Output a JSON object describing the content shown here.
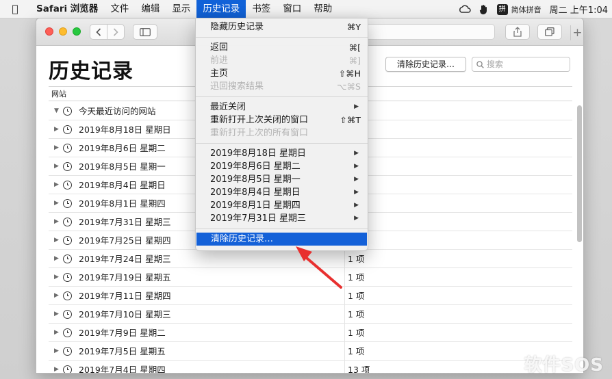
{
  "menubar": {
    "app_name": "Safari 浏览器",
    "menus": [
      "文件",
      "编辑",
      "显示",
      "历史记录",
      "书签",
      "窗口",
      "帮助"
    ],
    "active_menu": "历史记录",
    "input_method": {
      "badge": "拼",
      "label": "简体拼音"
    },
    "clock": "周二 上午1:04"
  },
  "history_menu": {
    "items": [
      {
        "label": "隐藏历史记录",
        "shortcut": "⌘Y",
        "disabled": false
      },
      {
        "sep": true
      },
      {
        "label": "返回",
        "shortcut": "⌘[",
        "disabled": false
      },
      {
        "label": "前进",
        "shortcut": "⌘]",
        "disabled": true
      },
      {
        "label": "主页",
        "shortcut": "⇧⌘H",
        "disabled": false
      },
      {
        "label": "迅回搜索结果",
        "shortcut": "⌥⌘S",
        "disabled": true
      },
      {
        "sep": true
      },
      {
        "label": "最近关闭",
        "submenu": true,
        "disabled": false
      },
      {
        "label": "重新打开上次关闭的窗口",
        "shortcut": "⇧⌘T",
        "disabled": false
      },
      {
        "label": "重新打开上次的所有窗口",
        "disabled": true
      },
      {
        "sep": true
      },
      {
        "label": "2019年8月18日 星期日",
        "submenu": true,
        "disabled": false
      },
      {
        "label": "2019年8月6日 星期二",
        "submenu": true,
        "disabled": false
      },
      {
        "label": "2019年8月5日 星期一",
        "submenu": true,
        "disabled": false
      },
      {
        "label": "2019年8月4日 星期日",
        "submenu": true,
        "disabled": false
      },
      {
        "label": "2019年8月1日 星期四",
        "submenu": true,
        "disabled": false
      },
      {
        "label": "2019年7月31日 星期三",
        "submenu": true,
        "disabled": false
      },
      {
        "sep": true
      },
      {
        "label": "清除历史记录…",
        "disabled": false,
        "highlighted": true
      }
    ]
  },
  "page": {
    "title": "历史记录",
    "clear_button": "清除历史记录…",
    "search_placeholder": "搜索",
    "column_header": "网站"
  },
  "history_rows": [
    {
      "date": "今天最近访问的网站",
      "count": "",
      "expanded": true
    },
    {
      "date": "2019年8月18日 星期日",
      "count": ""
    },
    {
      "date": "2019年8月6日 星期二",
      "count": ""
    },
    {
      "date": "2019年8月5日 星期一",
      "count": ""
    },
    {
      "date": "2019年8月4日 星期日",
      "count": ""
    },
    {
      "date": "2019年8月1日 星期四",
      "count": ""
    },
    {
      "date": "2019年7月31日 星期三",
      "count": ""
    },
    {
      "date": "2019年7月25日 星期四",
      "count": ""
    },
    {
      "date": "2019年7月24日 星期三",
      "count": "1 项"
    },
    {
      "date": "2019年7月19日 星期五",
      "count": "1 项"
    },
    {
      "date": "2019年7月11日 星期四",
      "count": "1 项"
    },
    {
      "date": "2019年7月10日 星期三",
      "count": "1 项"
    },
    {
      "date": "2019年7月9日 星期二",
      "count": "1 项"
    },
    {
      "date": "2019年7月5日 星期五",
      "count": "1 项"
    },
    {
      "date": "2019年7月4日 星期四",
      "count": "13 项"
    }
  ],
  "watermark": "软件SOS",
  "colors": {
    "menu_highlight": "#1461d8",
    "annotation_arrow": "#e8302f"
  }
}
